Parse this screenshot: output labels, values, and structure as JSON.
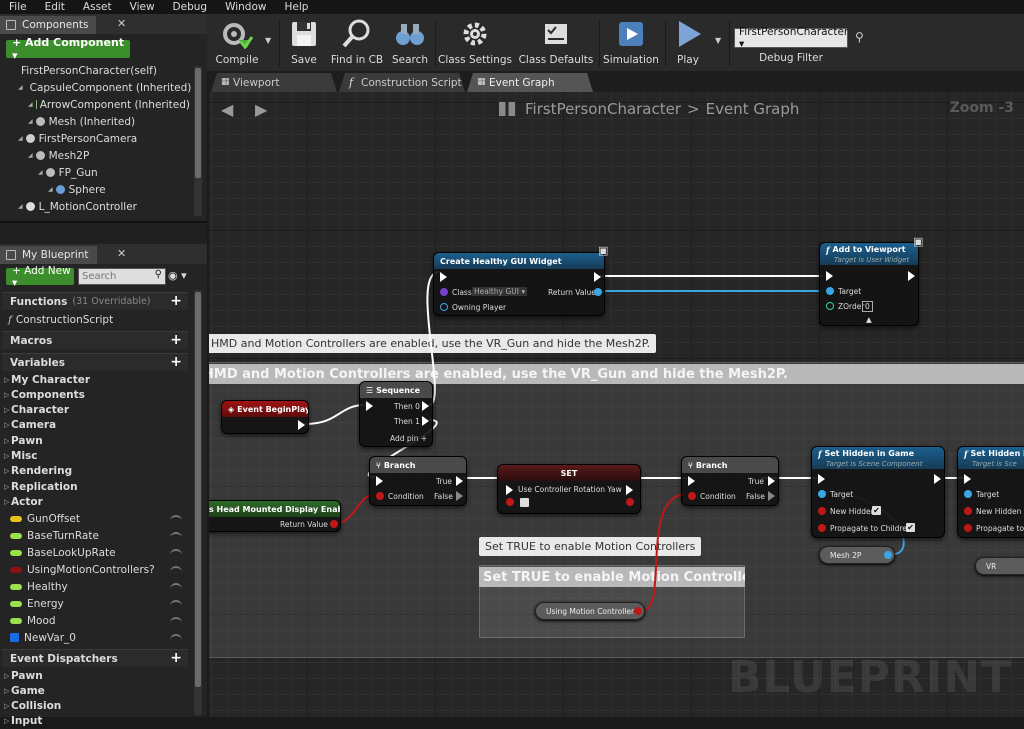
{
  "menu": [
    "File",
    "Edit",
    "Asset",
    "View",
    "Debug",
    "Window",
    "Help"
  ],
  "components_panel": {
    "tab": "Components",
    "add_component": "+ Add Component ▾",
    "tree": [
      {
        "label": "FirstPersonCharacter(self)",
        "indent": 0,
        "icon": "self-icon",
        "color": ""
      },
      {
        "label": "CapsuleComponent (Inherited)",
        "indent": 1,
        "icon": "capsule-icon",
        "color": "#6a9ed8"
      },
      {
        "label": "ArrowComponent (Inherited)",
        "indent": 2,
        "icon": "arrow-icon",
        "color": "#88b87a"
      },
      {
        "label": "Mesh (Inherited)",
        "indent": 2,
        "icon": "mesh-icon",
        "color": "#bbbbbb"
      },
      {
        "label": "FirstPersonCamera",
        "indent": 1,
        "icon": "camera-icon",
        "color": "#cccccc"
      },
      {
        "label": "Mesh2P",
        "indent": 2,
        "icon": "mesh-icon",
        "color": "#bbbbbb"
      },
      {
        "label": "FP_Gun",
        "indent": 3,
        "icon": "mesh-icon",
        "color": "#bbbbbb"
      },
      {
        "label": "Sphere",
        "indent": 4,
        "icon": "sphere-icon",
        "color": "#6a9ed8"
      },
      {
        "label": "L_MotionController",
        "indent": 1,
        "icon": "motion-controller-icon",
        "color": "#dddddd"
      }
    ]
  },
  "blueprint_panel": {
    "tab": "My Blueprint",
    "add_new": "+ Add New ▾",
    "search_placeholder": "Search",
    "functions": {
      "label": "Functions",
      "count": "(31 Overridable)"
    },
    "construction_script": "ConstructionScript",
    "macros": "Macros",
    "variables": "Variables",
    "var_categories": [
      "My Character",
      "Components",
      "Character",
      "Camera",
      "Pawn",
      "Misc",
      "Rendering",
      "Replication",
      "Actor"
    ],
    "variables_list": [
      {
        "name": "GunOffset",
        "color": "#e8c21a"
      },
      {
        "name": "BaseTurnRate",
        "color": "#9be04a"
      },
      {
        "name": "BaseLookUpRate",
        "color": "#9be04a"
      },
      {
        "name": "UsingMotionControllers?",
        "color": "#8c1010"
      },
      {
        "name": "Healthy",
        "color": "#9be04a"
      },
      {
        "name": "Energy",
        "color": "#9be04a"
      },
      {
        "name": "Mood",
        "color": "#9be04a"
      },
      {
        "name": "NewVar_0",
        "color": "#1a6be8",
        "square": true
      }
    ],
    "event_dispatchers": "Event Dispatchers",
    "dispatcher_categories": [
      "Pawn",
      "Game",
      "Collision",
      "Input"
    ]
  },
  "toolbar": {
    "compile": "Compile",
    "save": "Save",
    "find_in_cb": "Find in CB",
    "search": "Search",
    "class_settings": "Class Settings",
    "class_defaults": "Class Defaults",
    "simulation": "Simulation",
    "play": "Play",
    "debug_selected": "FirstPersonCharacter ▾",
    "debug_filter": "Debug Filter"
  },
  "doc_tabs": [
    "Viewport",
    "Construction Script",
    "Event Graph"
  ],
  "graph": {
    "breadcrumb_root": "FirstPersonCharacter",
    "breadcrumb_sep": ">",
    "breadcrumb_leaf": "Event Graph",
    "zoom": "Zoom -3",
    "comment1_bubble": "HMD and Motion Controllers are enabled, use the VR_Gun and hide the Mesh2P.",
    "comment1_band": "HMD and Motion Controllers are enabled, use the VR_Gun and hide the Mesh2P.",
    "comment2_bubble": "Set TRUE to enable Motion Controllers",
    "comment2_band": "Set TRUE to enable Motion Controllers",
    "watermark": "BLUEPRINT",
    "nodes": {
      "create_widget": {
        "title": "Create Healthy GUI Widget",
        "class_label": "Class",
        "class_value": "Healthy GUI ▾",
        "return_value": "Return Value",
        "owning_player": "Owning Player"
      },
      "add_viewport": {
        "title": "Add to Viewport",
        "subtitle": "Target is User Widget",
        "target": "Target",
        "zorder": "ZOrder",
        "zorder_value": "0"
      },
      "begin_play": {
        "title": "Event BeginPlay"
      },
      "sequence": {
        "title": "Sequence",
        "then0": "Then 0",
        "then1": "Then 1",
        "add_pin": "Add pin +"
      },
      "hmd_enabled": {
        "title": "Is Head Mounted Display Enabled",
        "return_value": "Return Value"
      },
      "branch1": {
        "title": "Branch",
        "true": "True",
        "false": "False",
        "condition": "Condition"
      },
      "set_node": {
        "title": "SET",
        "pin": "Use Controller Rotation Yaw"
      },
      "branch2": {
        "title": "Branch",
        "true": "True",
        "false": "False",
        "condition": "Condition"
      },
      "set_hidden1": {
        "title": "Set Hidden in Game",
        "subtitle": "Target is Scene Component",
        "target": "Target",
        "new_hidden": "New Hidden",
        "propagate": "Propagate to Children"
      },
      "set_hidden2": {
        "title": "Set Hidden in",
        "subtitle": "Target is Sce",
        "target": "Target",
        "new_hidden": "New Hidden",
        "propagate": "Propagate to"
      },
      "mesh2p_var": {
        "label": "Mesh 2P"
      },
      "vr_var": {
        "label": "VR"
      },
      "using_mc_var": {
        "label": "Using Motion Controllers?"
      }
    }
  }
}
